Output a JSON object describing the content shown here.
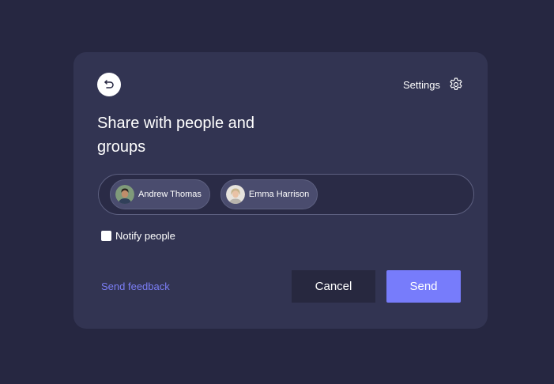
{
  "dialog": {
    "title": "Share with people and groups",
    "settings_label": "Settings",
    "recipients": [
      {
        "name": "Andrew Thomas",
        "avatar_icon": "person-avatar"
      },
      {
        "name": "Emma Harrison",
        "avatar_icon": "person-avatar"
      }
    ],
    "notify_label": "Notify people",
    "notify_checked": false,
    "feedback_link": "Send feedback",
    "cancel_label": "Cancel",
    "send_label": "Send"
  },
  "colors": {
    "background": "#262741",
    "card": "#323452",
    "accent": "#777cfb",
    "link": "#7b7ef5"
  }
}
